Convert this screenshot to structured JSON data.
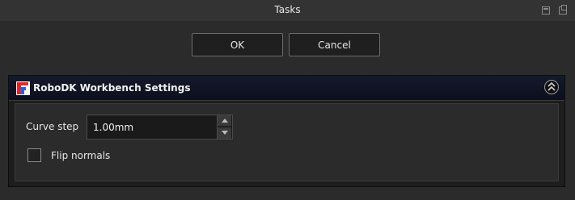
{
  "window": {
    "title": "Tasks"
  },
  "dialog": {
    "ok_label": "OK",
    "cancel_label": "Cancel"
  },
  "panel": {
    "title": "RoboDK Workbench Settings",
    "logo_icon": "robodk-logo",
    "collapse_icon": "double-chevron-up-icon",
    "curve_step": {
      "label": "Curve step",
      "value": "1.00mm"
    },
    "flip_normals": {
      "label": "Flip normals",
      "checked": false
    }
  },
  "colors": {
    "background": "#2b2b2b",
    "header": "#0c0f1c",
    "logo_red": "#e0262b",
    "logo_blue": "#2f5fd6"
  }
}
